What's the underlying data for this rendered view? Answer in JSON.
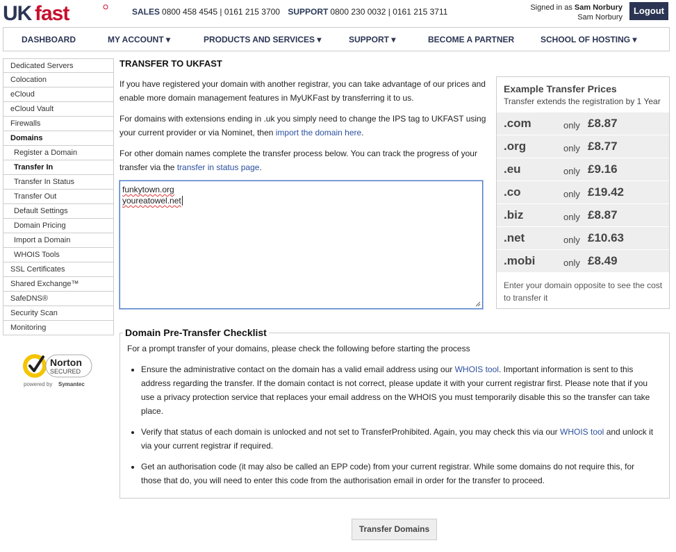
{
  "header": {
    "logo_text": "UKFast",
    "sales_label": "SALES",
    "sales_numbers": "0800 458 4545 | 0161 215 3700",
    "support_label": "SUPPORT",
    "support_numbers": "0800 230 0032 | 0161 215 3711",
    "signed_in_prefix": "Signed in as",
    "user_name": "Sam Norbury",
    "user_name_2": "Sam Norbury",
    "logout_label": "Logout"
  },
  "nav": {
    "items": [
      {
        "label": "DASHBOARD"
      },
      {
        "label": "MY ACCOUNT ▾"
      },
      {
        "label": "PRODUCTS AND SERVICES ▾"
      },
      {
        "label": "SUPPORT ▾"
      },
      {
        "label": "BECOME A PARTNER"
      },
      {
        "label": "SCHOOL OF HOSTING ▾"
      }
    ]
  },
  "sidebar": {
    "items": [
      {
        "label": "Dedicated Servers"
      },
      {
        "label": "Colocation"
      },
      {
        "label": "eCloud"
      },
      {
        "label": "eCloud Vault"
      },
      {
        "label": "Firewalls"
      },
      {
        "label": "Domains"
      },
      {
        "label": "Register a Domain"
      },
      {
        "label": "Transfer In"
      },
      {
        "label": "Transfer In Status"
      },
      {
        "label": "Transfer Out"
      },
      {
        "label": "Default Settings"
      },
      {
        "label": "Domain Pricing"
      },
      {
        "label": "Import a Domain"
      },
      {
        "label": "WHOIS Tools"
      },
      {
        "label": "SSL Certificates"
      },
      {
        "label": "Shared Exchange™"
      },
      {
        "label": "SafeDNS®"
      },
      {
        "label": "Security Scan"
      },
      {
        "label": "Monitoring"
      }
    ],
    "norton": {
      "brand": "Norton",
      "secured": "SECURED",
      "powered_by": "powered by",
      "symantec": "Symantec"
    }
  },
  "main": {
    "title": "TRANSFER TO UKFAST",
    "p1": "If you have registered your domain with another registrar, you can take advantage of our prices and enable more domain management features in MyUKFast by transferring it to us.",
    "p2_text": "For domains with extensions ending in .uk you simply need to change the IPS tag to UKFAST using your current provider or via Nominet, then ",
    "p2_link": "import the domain here",
    "p2_end": ".",
    "p3_text": "For other domain names complete the transfer process below. You can track the progress of your transfer via the ",
    "p3_link": "transfer in status page",
    "p3_end": ".",
    "domains_value": [
      "funkytown.org",
      "youreatowel.net"
    ]
  },
  "prices": {
    "heading": "Example Transfer Prices",
    "subheading": "Transfer extends the registration by 1 Year",
    "only_label": "only",
    "rows": [
      {
        "ext": ".com",
        "price": "£8.87"
      },
      {
        "ext": ".org",
        "price": "£8.77"
      },
      {
        "ext": ".eu",
        "price": "£9.16"
      },
      {
        "ext": ".co",
        "price": "£19.42"
      },
      {
        "ext": ".biz",
        "price": "£8.87"
      },
      {
        "ext": ".net",
        "price": "£10.63"
      },
      {
        "ext": ".mobi",
        "price": "£8.49"
      }
    ],
    "footer": "Enter your domain opposite to see the cost to transfer it"
  },
  "checklist": {
    "legend": "Domain Pre-Transfer Checklist",
    "intro": "For a prompt transfer of your domains, please check the following before starting the process",
    "item1_a": "Ensure the administrative contact on the domain has a valid email address using our ",
    "item1_link": "WHOIS tool",
    "item1_b": ". Important information is sent to this address regarding the transfer. If the domain contact is not correct, please update it with your current registrar first. Please note that if you use a privacy protection service that replaces your email address on the WHOIS you must temporarily disable this so the transfer can take place.",
    "item2_a": "Verify that status of each domain is unlocked and not set to TransferProhibited. Again, you may check this via our ",
    "item2_link": "WHOIS tool",
    "item2_b": " and unlock it via your current registrar if required.",
    "item3": "Get an authorisation code (it may also be called an EPP code) from your current registrar. While some domains do not require this, for those that do, you will need to enter this code from the authorisation email in order for the transfer to proceed."
  },
  "submit_label": "Transfer Domains",
  "colors": {
    "navy": "#2b3553",
    "brand_red": "#c8102e",
    "link": "#2b4f9e"
  }
}
